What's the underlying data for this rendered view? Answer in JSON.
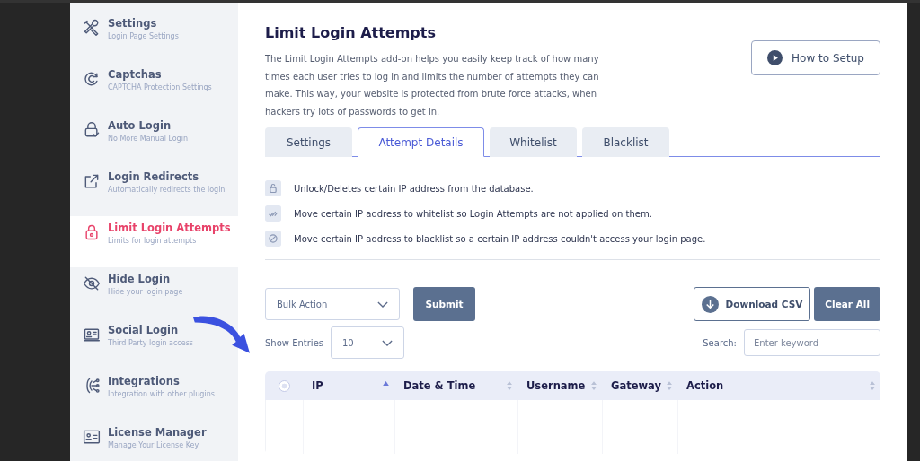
{
  "sidebar": {
    "items": [
      {
        "kind": "tools",
        "title": "Settings",
        "subtitle": "Login Page Settings",
        "selected": false
      },
      {
        "kind": "captcha",
        "title": "Captchas",
        "subtitle": "CAPTCHA Protection Settings",
        "selected": false
      },
      {
        "kind": "autologin",
        "title": "Auto Login",
        "subtitle": "No More Manual Login",
        "selected": false
      },
      {
        "kind": "redirect",
        "title": "Login Redirects",
        "subtitle": "Automatically redirects the login",
        "selected": false
      },
      {
        "kind": "limit",
        "title": "Limit Login Attempts",
        "subtitle": "Limits for login attempts",
        "selected": true
      },
      {
        "kind": "hide",
        "title": "Hide Login",
        "subtitle": "Hide your login page",
        "selected": false
      },
      {
        "kind": "social",
        "title": "Social Login",
        "subtitle": "Third Party login access",
        "selected": false
      },
      {
        "kind": "integrations",
        "title": "Integrations",
        "subtitle": "Integration with other plugins",
        "selected": false
      },
      {
        "kind": "license",
        "title": "License Manager",
        "subtitle": "Manage Your License Key",
        "selected": false
      }
    ]
  },
  "page": {
    "title": "Limit Login Attempts",
    "description": "The Limit Login Attempts add-on helps you easily keep track of how many times each user tries to log in and limits the number of attempts they can make. This way, your website is protected from brute force attacks, when hackers try lots of passwords to get in.",
    "how_to_button": "How to Setup"
  },
  "tabs": [
    {
      "label": "Settings",
      "selected": false
    },
    {
      "label": "Attempt Details",
      "selected": true
    },
    {
      "label": "Whitelist",
      "selected": false
    },
    {
      "label": "Blacklist",
      "selected": false
    }
  ],
  "legend": [
    {
      "kind": "unlock",
      "text": "Unlock/Deletes certain IP address from the database."
    },
    {
      "kind": "whitelist",
      "text": "Move certain IP address to whitelist so Login Attempts are not applied on them."
    },
    {
      "kind": "blacklist",
      "text": "Move certain IP address to blacklist so a certain IP address couldn't access your login page."
    }
  ],
  "toolbar": {
    "bulk_action": "Bulk Action",
    "submit": "Submit",
    "download": "Download CSV",
    "clear": "Clear All",
    "show_entries_label": "Show Entries",
    "entries": "10",
    "search_label": "Search:",
    "search_placeholder": "Enter keyword"
  },
  "table": {
    "select_all": {
      "checked": false
    },
    "columns": [
      {
        "label": "IP",
        "sorted": true
      },
      {
        "label": "Date & Time",
        "sorted": false
      },
      {
        "label": "Username",
        "sorted": false
      },
      {
        "label": "Gateway",
        "sorted": false
      },
      {
        "label": "Action",
        "sorted": false
      }
    ]
  }
}
